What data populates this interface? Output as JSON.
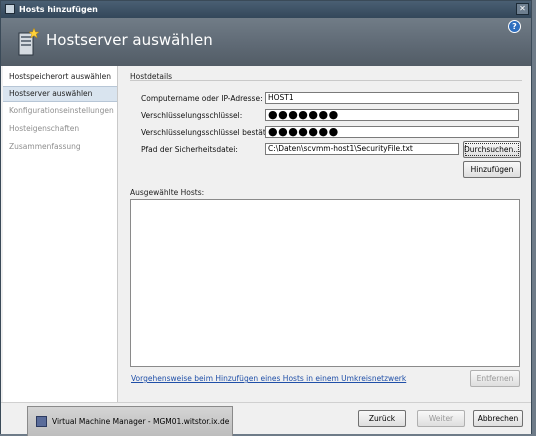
{
  "window": {
    "title": "Hosts hinzufügen",
    "close_glyph": "✕"
  },
  "header": {
    "title": "Hostserver auswählen",
    "help_glyph": "?",
    "icon": "server-wizard-icon"
  },
  "sidebar": {
    "items": [
      {
        "label": "Hostspeicherort auswählen",
        "state": "normal"
      },
      {
        "label": "Hostserver auswählen",
        "state": "active"
      },
      {
        "label": "Konfigurationseinstellungen",
        "state": "disabled"
      },
      {
        "label": "Hosteigenschaften",
        "state": "disabled"
      },
      {
        "label": "Zusammenfassung",
        "state": "disabled"
      }
    ]
  },
  "hostdetails": {
    "section_title": "Hostdetails",
    "computer_label": "Computername oder IP-Adresse:",
    "computer_value": "HOST1",
    "key_label": "Verschlüsselungsschlüssel:",
    "key_value": "●●●●●●●",
    "key_confirm_label": "Verschlüsselungsschlüssel bestätigen:",
    "key_confirm_value": "●●●●●●●",
    "file_label": "Pfad der Sicherheitsdatei:",
    "file_value": "C:\\Daten\\scvmm-host1\\SecurityFile.txt",
    "browse_label": "Durchsuchen...",
    "add_label": "Hinzufügen"
  },
  "hosts": {
    "label": "Ausgewählte Hosts:",
    "items": []
  },
  "link_text": "Vorgehensweise beim Hinzufügen eines Hosts in einem Umkreisnetzwerk",
  "remove_label": "Entfernen",
  "footer": {
    "back_label": "Zurück",
    "next_label": "Weiter",
    "cancel_label": "Abbrechen"
  },
  "taskbar": {
    "label": "Virtual Machine Manager - MGM01.witstor.ix.de"
  },
  "colors": {
    "header_bg": "#5f6a75",
    "active_item_bg": "#d9e4ef",
    "link": "#1f4fa8"
  }
}
